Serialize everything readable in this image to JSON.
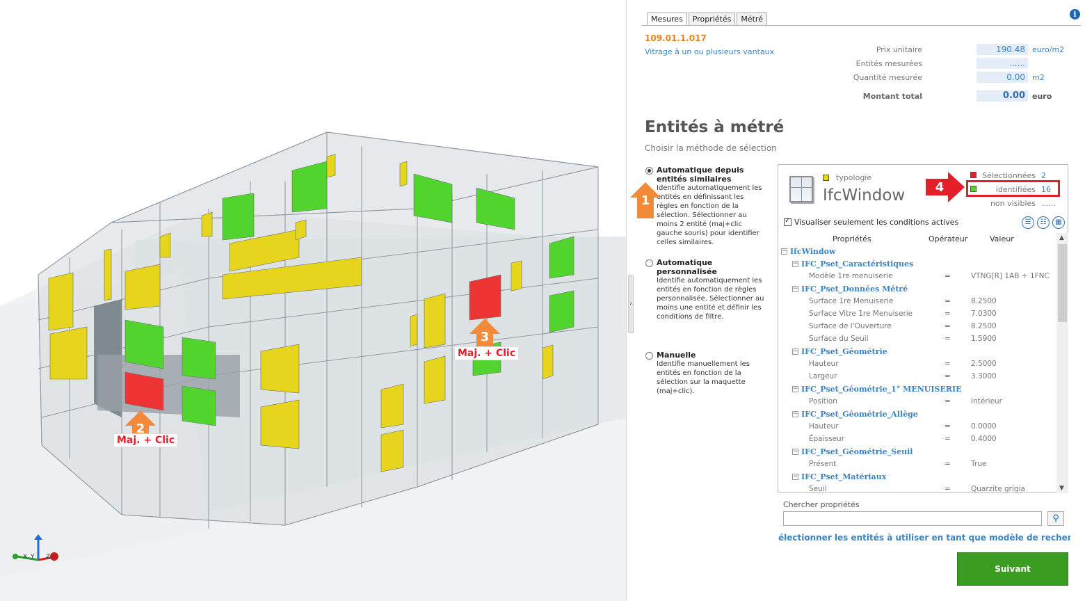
{
  "tabs": [
    {
      "label": "Mesures",
      "active": true
    },
    {
      "label": "Propriétés",
      "active": false
    },
    {
      "label": "Métré",
      "active": false
    }
  ],
  "item": {
    "code": "109.01.1.017",
    "description": "Vitrage à un ou plusieurs vantaux"
  },
  "pricing": {
    "unit_price": {
      "label": "Prix unitaire",
      "value": "190.48",
      "unit": "euro/m2"
    },
    "measured_entities": {
      "label": "Entités mesurées",
      "value": "......",
      "unit": ""
    },
    "measured_quantity": {
      "label": "Quantité mesurée",
      "value": "0.00",
      "unit": "m2"
    },
    "total": {
      "label": "Montant total",
      "value": "0.00",
      "unit": "euro"
    }
  },
  "section": {
    "title": "Entités à métré",
    "subtitle": "Choisir la méthode de sélection"
  },
  "methods": [
    {
      "title": "Automatique depuis entités similaires",
      "selected": true,
      "description": "Identifie automatiquement les entités en définissant les règles en fonction de la sélection. Sélectionner au moins 2 entité (maj+clic gauche souris) pour identifier celles similaires."
    },
    {
      "title": "Automatique personnalisée",
      "selected": false,
      "description": "Identifie automatiquement les entités en fonction de règles personnalisée. Sélectionner au moins une entité et définir les conditions de filtre."
    },
    {
      "title": "Manuelle",
      "selected": false,
      "description": "Identifie manuellement les entités en fonction de la sélection sur la maquette (maj+clic)."
    }
  ],
  "entity": {
    "typology_label": "typologie",
    "type_name": "IfcWindow",
    "stats": [
      {
        "label": "Sélectionnées",
        "value": "2",
        "color": "#e3202a"
      },
      {
        "label": "identifiées",
        "value": "16",
        "color": "#52d42f"
      },
      {
        "label": "non visibles",
        "value": "......",
        "color": ""
      }
    ],
    "typology_color": "#e7d51d"
  },
  "filter": {
    "active_only_label": "Visualiser seulement les conditions actives",
    "active_only_checked": true,
    "columns": [
      "Propriétés",
      "Opérateur",
      "Valeur"
    ]
  },
  "tree": [
    {
      "kind": "root",
      "name": "IfcWindow"
    },
    {
      "kind": "group",
      "name": "IFC_Pset_Caractéristiques"
    },
    {
      "kind": "prop",
      "name": "Modèle 1re menuiserie",
      "op": "=",
      "value": "VTNG[R] 1AB + 1FNC"
    },
    {
      "kind": "group",
      "name": "IFC_Pset_Données Métré"
    },
    {
      "kind": "prop",
      "name": "Surface 1re Menuiserie",
      "op": "=",
      "value": "8.2500"
    },
    {
      "kind": "prop",
      "name": "Surface Vitre 1re Menuiserie",
      "op": "=",
      "value": "7.0300"
    },
    {
      "kind": "prop",
      "name": "Surface de l'Ouverture",
      "op": "=",
      "value": "8.2500"
    },
    {
      "kind": "prop",
      "name": "Surface du Seuil",
      "op": "=",
      "value": "1.5900"
    },
    {
      "kind": "group",
      "name": "IFC_Pset_Géométrie"
    },
    {
      "kind": "prop",
      "name": "Hauteur",
      "op": "=",
      "value": "2.5000"
    },
    {
      "kind": "prop",
      "name": "Largeur",
      "op": "=",
      "value": "3.3000"
    },
    {
      "kind": "group",
      "name": "IFC_Pset_Géométrie_1° MENUISERIE"
    },
    {
      "kind": "prop",
      "name": "Position",
      "op": "=",
      "value": "Intérieur"
    },
    {
      "kind": "group",
      "name": "IFC_Pset_Géométrie_Allège"
    },
    {
      "kind": "prop",
      "name": "Hauteur",
      "op": "=",
      "value": "0.0000"
    },
    {
      "kind": "prop",
      "name": "Épaisseur",
      "op": "=",
      "value": "0.4000"
    },
    {
      "kind": "group",
      "name": "IFC_Pset_Géométrie_Seuil"
    },
    {
      "kind": "prop",
      "name": "Présent",
      "op": "=",
      "value": "True"
    },
    {
      "kind": "group",
      "name": "IFC_Pset_Matériaux"
    },
    {
      "kind": "prop",
      "name": "Seuil",
      "op": "=",
      "value": "Quarzite grigia"
    }
  ],
  "search": {
    "label": "Chercher propriétés",
    "value": ""
  },
  "footer_hint": "électionner les entités à utiliser en tant que modèle de recherch",
  "next_button": "Suivant",
  "callouts": [
    {
      "number": "1",
      "label": ""
    },
    {
      "number": "2",
      "label": "Maj. + Clic"
    },
    {
      "number": "3",
      "label": "Maj. + Clic"
    },
    {
      "number": "4",
      "label": ""
    }
  ],
  "axes": {
    "x": "X",
    "y": "Y",
    "z": "Z"
  },
  "colors": {
    "accent": "#3a84c4",
    "code": "#e8821c",
    "next": "#3a9d22",
    "callout_orange": "#f28a3a",
    "callout_red": "#e3202a",
    "window_yellow": "#e7d51d",
    "window_green": "#52d42f",
    "window_red": "#ef3434"
  }
}
